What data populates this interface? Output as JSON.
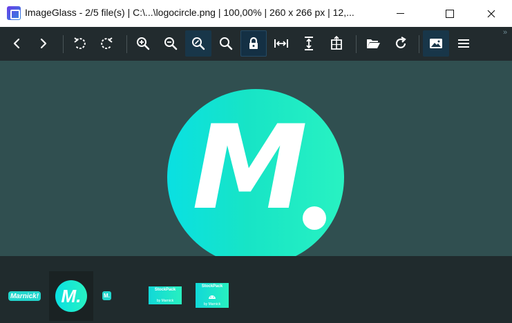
{
  "window": {
    "title": "ImageGlass - 2/5 file(s)  |  C:\\...\\logocircle.png  |  100,00%  |  260 x 266 px  |  12,..."
  },
  "toolbar": {
    "buttons": [
      {
        "name": "view-previous-image",
        "icon": "chevron-left-icon"
      },
      {
        "name": "view-next-image",
        "icon": "chevron-right-icon"
      },
      {
        "name": "rotate-left",
        "icon": "rotate-left-icon"
      },
      {
        "name": "rotate-right",
        "icon": "rotate-right-icon"
      },
      {
        "name": "zoom-in",
        "icon": "zoom-in-icon"
      },
      {
        "name": "zoom-out",
        "icon": "zoom-out-icon"
      },
      {
        "name": "zoom-to-fit",
        "icon": "zoom-fit-icon",
        "active": true
      },
      {
        "name": "actual-size",
        "icon": "zoom-actual-icon"
      },
      {
        "name": "lock-zoom-ratio",
        "icon": "lock-icon",
        "active": true
      },
      {
        "name": "scale-to-width",
        "icon": "scale-width-icon"
      },
      {
        "name": "scale-to-height",
        "icon": "scale-height-icon"
      },
      {
        "name": "auto-zoom",
        "icon": "auto-zoom-icon"
      },
      {
        "name": "open-file",
        "icon": "folder-open-icon"
      },
      {
        "name": "refresh",
        "icon": "refresh-icon"
      },
      {
        "name": "thumbnail-bar",
        "icon": "image-icon",
        "active": true
      },
      {
        "name": "main-menu",
        "icon": "hamburger-menu-icon"
      }
    ],
    "overflow_glyph": "»"
  },
  "image": {
    "logo_letter": "M",
    "colors": {
      "gradient_start": "#0ae0e2",
      "gradient_end": "#28f2c2",
      "viewer_bg": "#304f50"
    }
  },
  "thumbnails": [
    {
      "label": "Marnick!"
    },
    {
      "label": "M.",
      "selected": true
    },
    {
      "label": "M."
    },
    {
      "title": "StockPack",
      "subtitle": "by Marnick"
    },
    {
      "title": "StockPack",
      "subtitle": "by Marnick"
    }
  ]
}
